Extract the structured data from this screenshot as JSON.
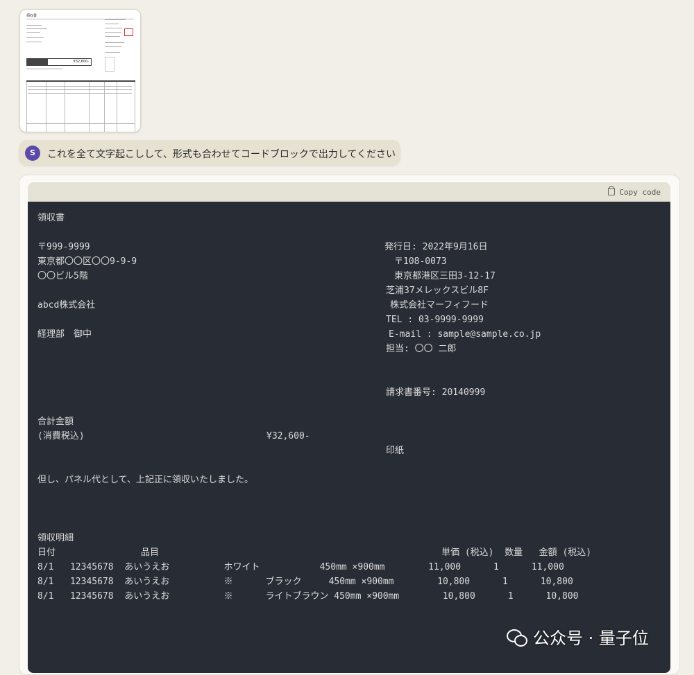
{
  "attachment": {
    "title": "領収書",
    "amount": "¥32,600-"
  },
  "user_message": {
    "avatar_letter": "S",
    "text": "これを全て文字起こしして、形式も合わせてコードブロックで出力してください"
  },
  "code_block": {
    "copy_label": "Copy code",
    "lines": {
      "title": "領収書",
      "postal": "〒999-9999",
      "address1": "東京都〇〇区〇〇9-9-9",
      "address2": "〇〇ビル5階",
      "company": "abcd株式会社",
      "dept": "経理部　御中",
      "issue_date": "発行日: 2022年9月16日",
      "issuer_postal": "〒108-0073",
      "issuer_address1": "東京都港区三田3-12-17",
      "issuer_address2": "芝浦37メレックスビル8F",
      "issuer_company": "株式会社マーフィフード",
      "issuer_tel": "TEL : 03-9999-9999",
      "issuer_email": "E-mail : sample@sample.co.jp",
      "issuer_person": "担当: 〇〇 二郎",
      "invoice_no": "請求書番号: 20140999",
      "total_label": "合計金額",
      "tax_label": "(消費税込)",
      "total_value": "¥32,600-",
      "stamp": "印紙",
      "note": "但し、パネル代として、上記正に領収いたしました。",
      "detail_title": "領収明細",
      "header_date": "日付",
      "header_item": "品目",
      "header_right": "単価 (税込)  数量   金額 (税込)",
      "row1": "8/1   12345678  あいうえお          ホワイト           450mm ×900mm        11,000      1      11,000",
      "row2": "8/1   12345678  あいうえお          ※      ブラック     450mm ×900mm        10,800      1      10,800",
      "row3": "8/1   12345678  あいうえお          ※      ライトブラウン 450mm ×900mm        10,800      1      10,800"
    }
  },
  "watermark": {
    "text": "公众号 · 量子位"
  }
}
